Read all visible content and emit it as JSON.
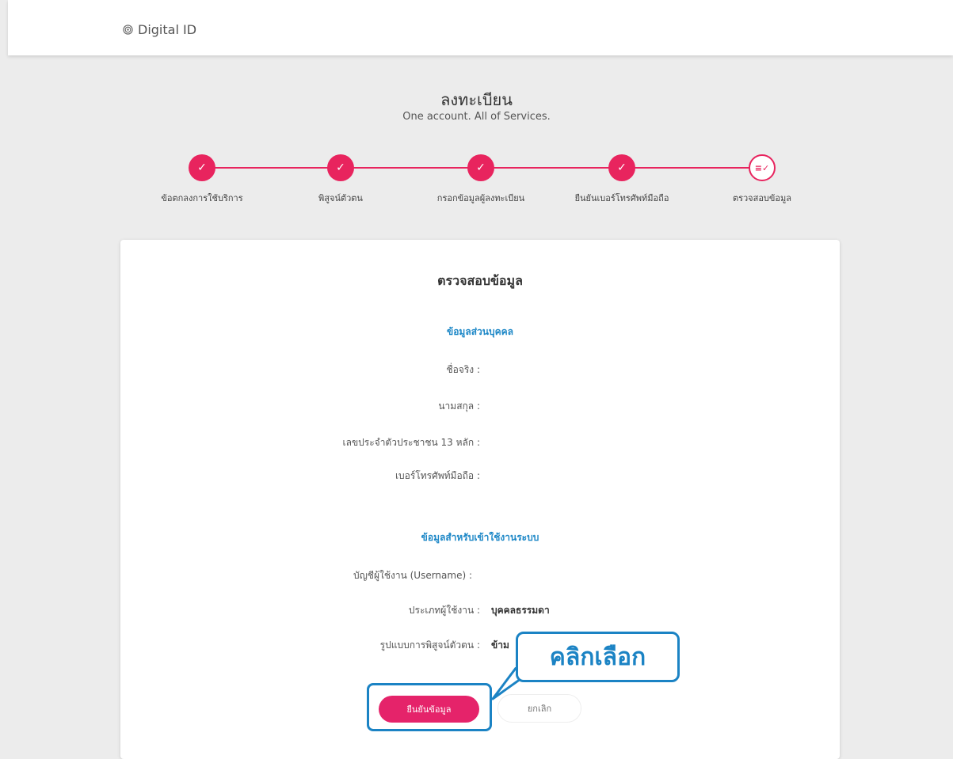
{
  "header": {
    "brand": "Digital ID"
  },
  "page": {
    "title": "ลงทะเบียน",
    "subtitle": "One account. All of Services."
  },
  "steps": [
    {
      "label": "ข้อตกลงการใช้บริการ",
      "status": "done"
    },
    {
      "label": "พิสูจน์ตัวตน",
      "status": "done"
    },
    {
      "label": "กรอกข้อมูลผู้ลงทะเบียน",
      "status": "done"
    },
    {
      "label": "ยืนยันเบอร์โทรศัพท์มือถือ",
      "status": "done"
    },
    {
      "label": "ตรวจสอบข้อมูล",
      "status": "current"
    }
  ],
  "card": {
    "title": "ตรวจสอบข้อมูล",
    "personal_section": "ข้อมูลส่วนบุคคล",
    "personal_rows": [
      {
        "label": "ชื่อจริง :",
        "value": ""
      },
      {
        "label": "นามสกุล :",
        "value": ""
      },
      {
        "label": "เลขประจำตัวประชาชน 13 หลัก :",
        "value": ""
      },
      {
        "label": "เบอร์โทรศัพท์มือถือ :",
        "value": ""
      }
    ],
    "login_section": "ข้อมูลสำหรับเข้าใช้งานระบบ",
    "login_rows": [
      {
        "label": "บัญชีผู้ใช้งาน (Username) :",
        "value": ""
      },
      {
        "label": "ประเภทผู้ใช้งาน :",
        "value": "บุคคลธรรมดา"
      },
      {
        "label": "รูปแบบการพิสูจน์ตัวตน :",
        "value": "ข้าม"
      }
    ]
  },
  "buttons": {
    "confirm": "ยืนยันข้อมูล",
    "cancel": "ยกเลิก"
  },
  "annotation": {
    "callout": "คลิกเลือก"
  },
  "colors": {
    "accent": "#e8245e",
    "link": "#1e88c7",
    "highlight": "#1b83c4"
  }
}
